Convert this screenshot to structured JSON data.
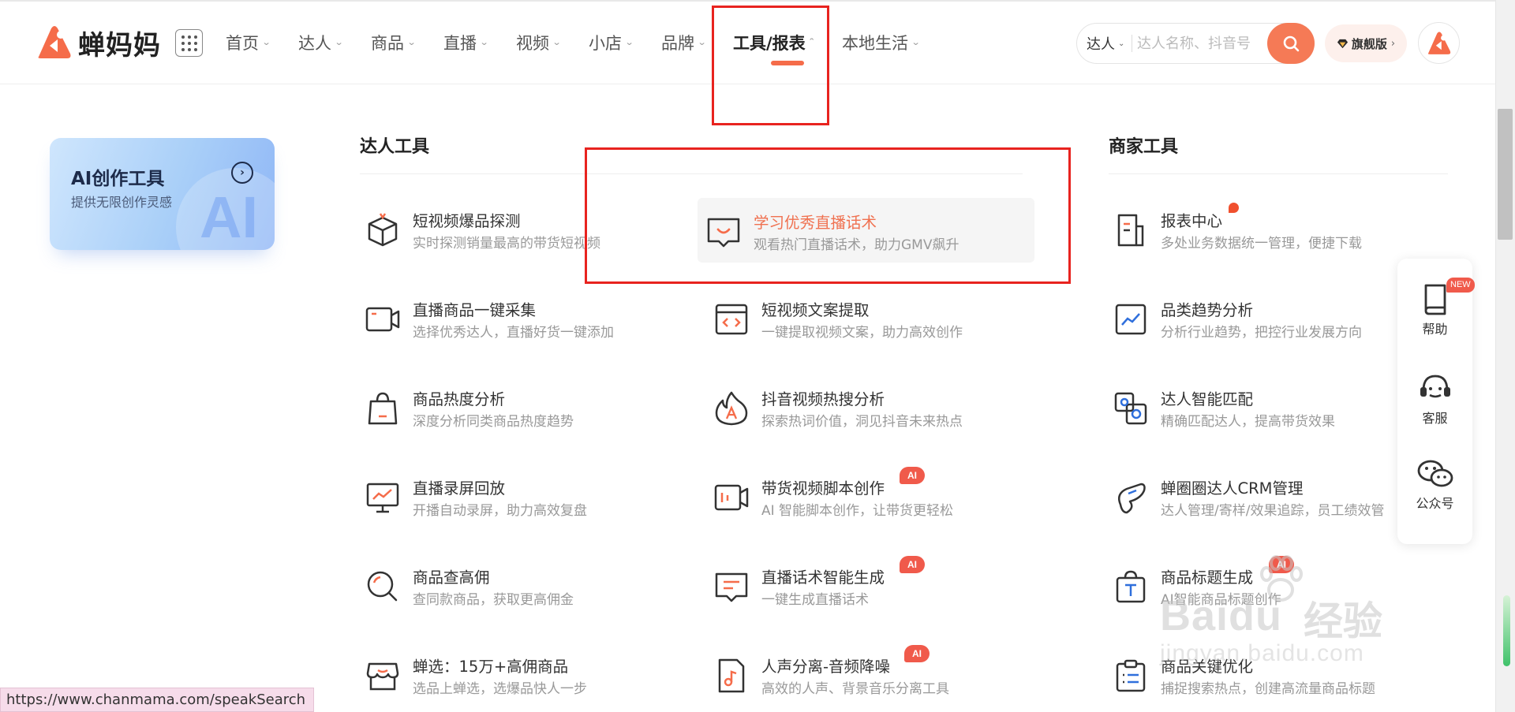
{
  "brand": {
    "name": "蝉妈妈",
    "accent": "#f56c4a"
  },
  "nav": {
    "items": [
      {
        "label": "首页",
        "active": false
      },
      {
        "label": "达人",
        "active": false
      },
      {
        "label": "商品",
        "active": false
      },
      {
        "label": "直播",
        "active": false
      },
      {
        "label": "视频",
        "active": false
      },
      {
        "label": "小店",
        "active": false
      },
      {
        "label": "品牌",
        "active": false
      },
      {
        "label": "工具/报表",
        "active": true
      },
      {
        "label": "本地生活",
        "active": false
      }
    ]
  },
  "search": {
    "type": "达人",
    "placeholder": "达人名称、抖音号"
  },
  "vip": {
    "label": "旗舰版"
  },
  "ai_card": {
    "title": "AI创作工具",
    "subtitle": "提供无限创作灵感",
    "watermark": "AI"
  },
  "sections": {
    "influencer_tools": "达人工具",
    "merchant_tools": "商家工具"
  },
  "col1": [
    {
      "title": "短视频爆品探测",
      "desc": "实时探测销量最高的带货短视频",
      "icon": "box-icon"
    },
    {
      "title": "直播商品一键采集",
      "desc": "选择优秀达人，直播好货一键添加",
      "icon": "camera-icon"
    },
    {
      "title": "商品热度分析",
      "desc": "深度分析同类商品热度趋势",
      "icon": "shopping-bag-icon"
    },
    {
      "title": "直播录屏回放",
      "desc": "开播自动录屏，助力高效复盘",
      "icon": "monitor-chart-icon"
    },
    {
      "title": "商品查高佣",
      "desc": "查同款商品，获取更高佣金",
      "icon": "magnifier-icon"
    },
    {
      "title": "蝉选：15万+高佣商品",
      "desc": "选品上蝉选，选爆品快人一步",
      "icon": "store-icon"
    }
  ],
  "col2": [
    {
      "title": "学习优秀直播话术",
      "desc": "观看热门直播话术，助力GMV飙升",
      "icon": "chat-smile-icon",
      "highlight": true
    },
    {
      "title": "短视频文案提取",
      "desc": "一键提取视频文案，助力高效创作",
      "icon": "code-window-icon"
    },
    {
      "title": "抖音视频热搜分析",
      "desc": "探索热词价值，洞见抖音未来热点",
      "icon": "flame-icon"
    },
    {
      "title": "带货视频脚本创作",
      "desc": "AI 智能脚本创作，让带货更轻松",
      "icon": "video-script-icon",
      "badge": "AI"
    },
    {
      "title": "直播话术智能生成",
      "desc": "一键生成直播话术",
      "icon": "chat-lines-icon",
      "badge": "AI"
    },
    {
      "title": "人声分离-音频降噪",
      "desc": "高效的人声、背景音乐分离工具",
      "icon": "music-file-icon",
      "badge": "AI"
    }
  ],
  "col3": [
    {
      "title": "报表中心",
      "desc": "多处业务数据统一管理，便捷下载",
      "icon": "report-doc-icon",
      "dot": true
    },
    {
      "title": "品类趋势分析",
      "desc": "分析行业趋势，把控行业发展方向",
      "icon": "trend-chart-icon"
    },
    {
      "title": "达人智能匹配",
      "desc": "精确匹配达人，提高带货效果",
      "icon": "match-icon"
    },
    {
      "title": "蝉圈圈达人CRM管理",
      "desc": "达人管理/寄样/效果追踪，员工绩效管",
      "icon": "crm-icon"
    },
    {
      "title": "商品标题生成",
      "desc": "AI智能商品标题创作",
      "icon": "title-bag-icon",
      "badge": "AI"
    },
    {
      "title": "商品关键优化",
      "desc": "捕捉搜索热点，创建高流量商品标题",
      "icon": "clipboard-list-icon"
    }
  ],
  "float_panel": [
    {
      "label": "帮助",
      "icon": "book-icon",
      "badge": "NEW"
    },
    {
      "label": "客服",
      "icon": "headset-icon"
    },
    {
      "label": "公众号",
      "icon": "wechat-icon"
    }
  ],
  "status_bar": {
    "url": "https://www.chanmama.com/speakSearch"
  },
  "watermark": {
    "line1": "Baidu",
    "line2": "经验",
    "line3": "jingyan.baidu.com"
  }
}
